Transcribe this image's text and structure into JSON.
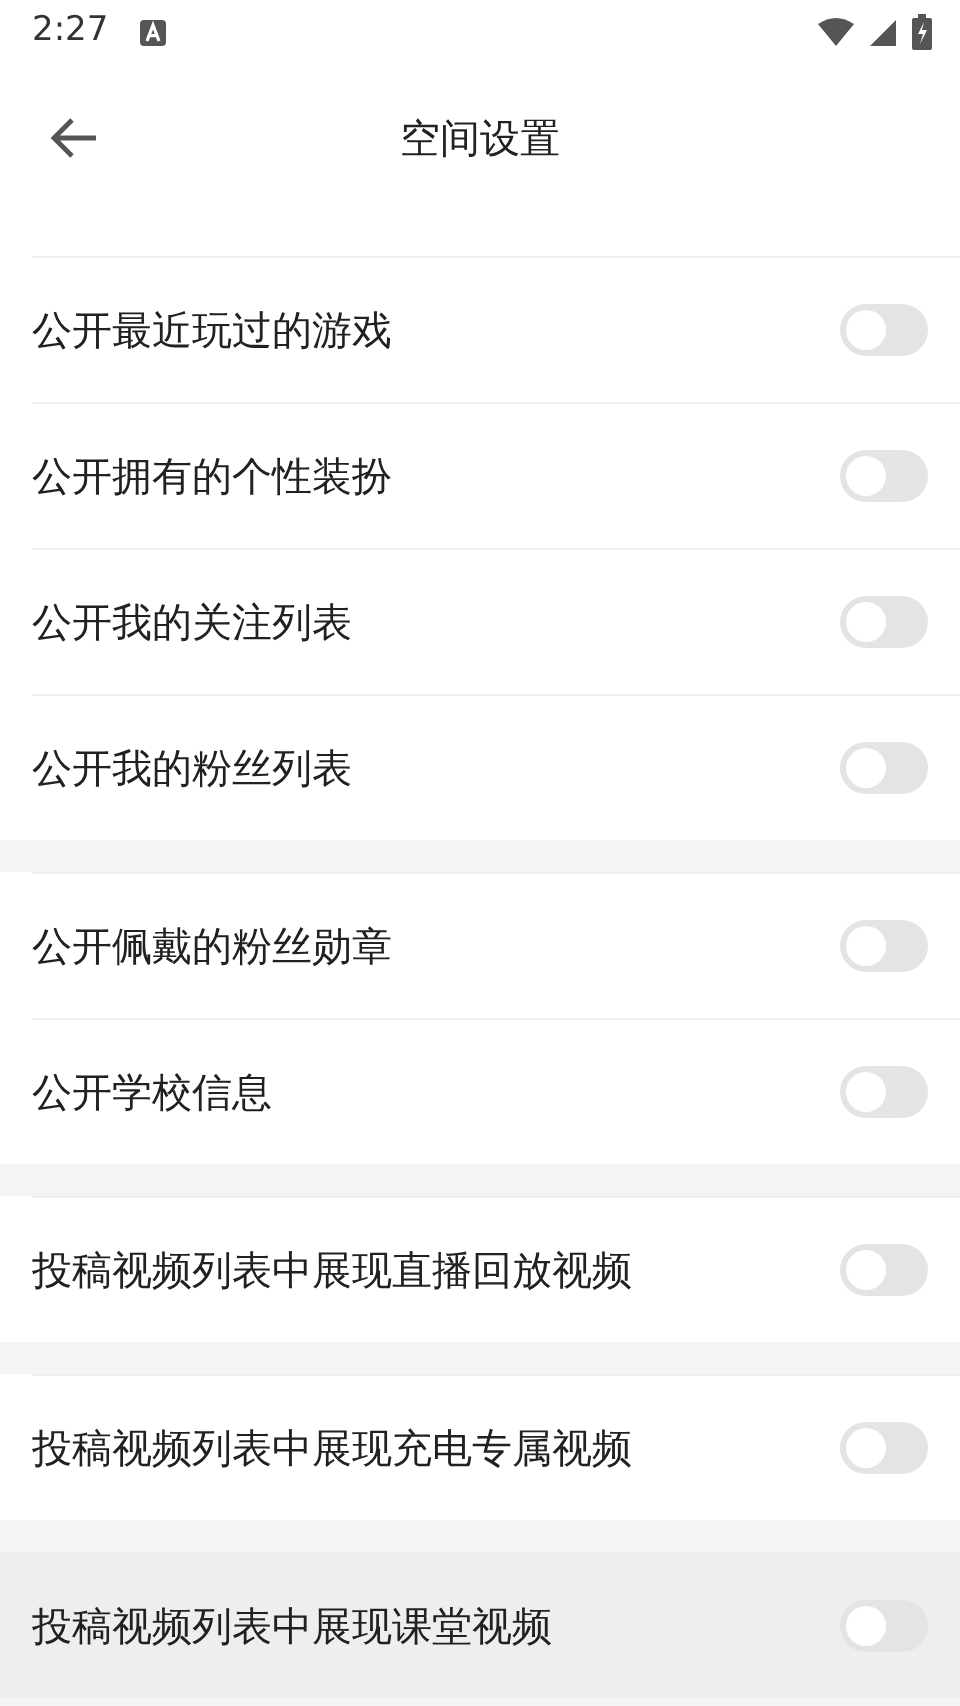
{
  "status_bar": {
    "time": "2:27"
  },
  "header": {
    "title": "空间设置"
  },
  "groups": [
    {
      "items": [
        {
          "label": "公开最近玩过的游戏",
          "on": false,
          "pressed": false
        },
        {
          "label": "公开拥有的个性装扮",
          "on": false,
          "pressed": false
        },
        {
          "label": "公开我的关注列表",
          "on": false,
          "pressed": false
        },
        {
          "label": "公开我的粉丝列表",
          "on": false,
          "pressed": false
        }
      ]
    },
    {
      "items": [
        {
          "label": "公开佩戴的粉丝勋章",
          "on": false,
          "pressed": false
        },
        {
          "label": "公开学校信息",
          "on": false,
          "pressed": false
        }
      ]
    },
    {
      "items": [
        {
          "label": "投稿视频列表中展现直播回放视频",
          "on": false,
          "pressed": false
        }
      ]
    },
    {
      "items": [
        {
          "label": "投稿视频列表中展现充电专属视频",
          "on": false,
          "pressed": false
        }
      ]
    },
    {
      "items": [
        {
          "label": "投稿视频列表中展现课堂视频",
          "on": false,
          "pressed": true
        }
      ]
    }
  ]
}
